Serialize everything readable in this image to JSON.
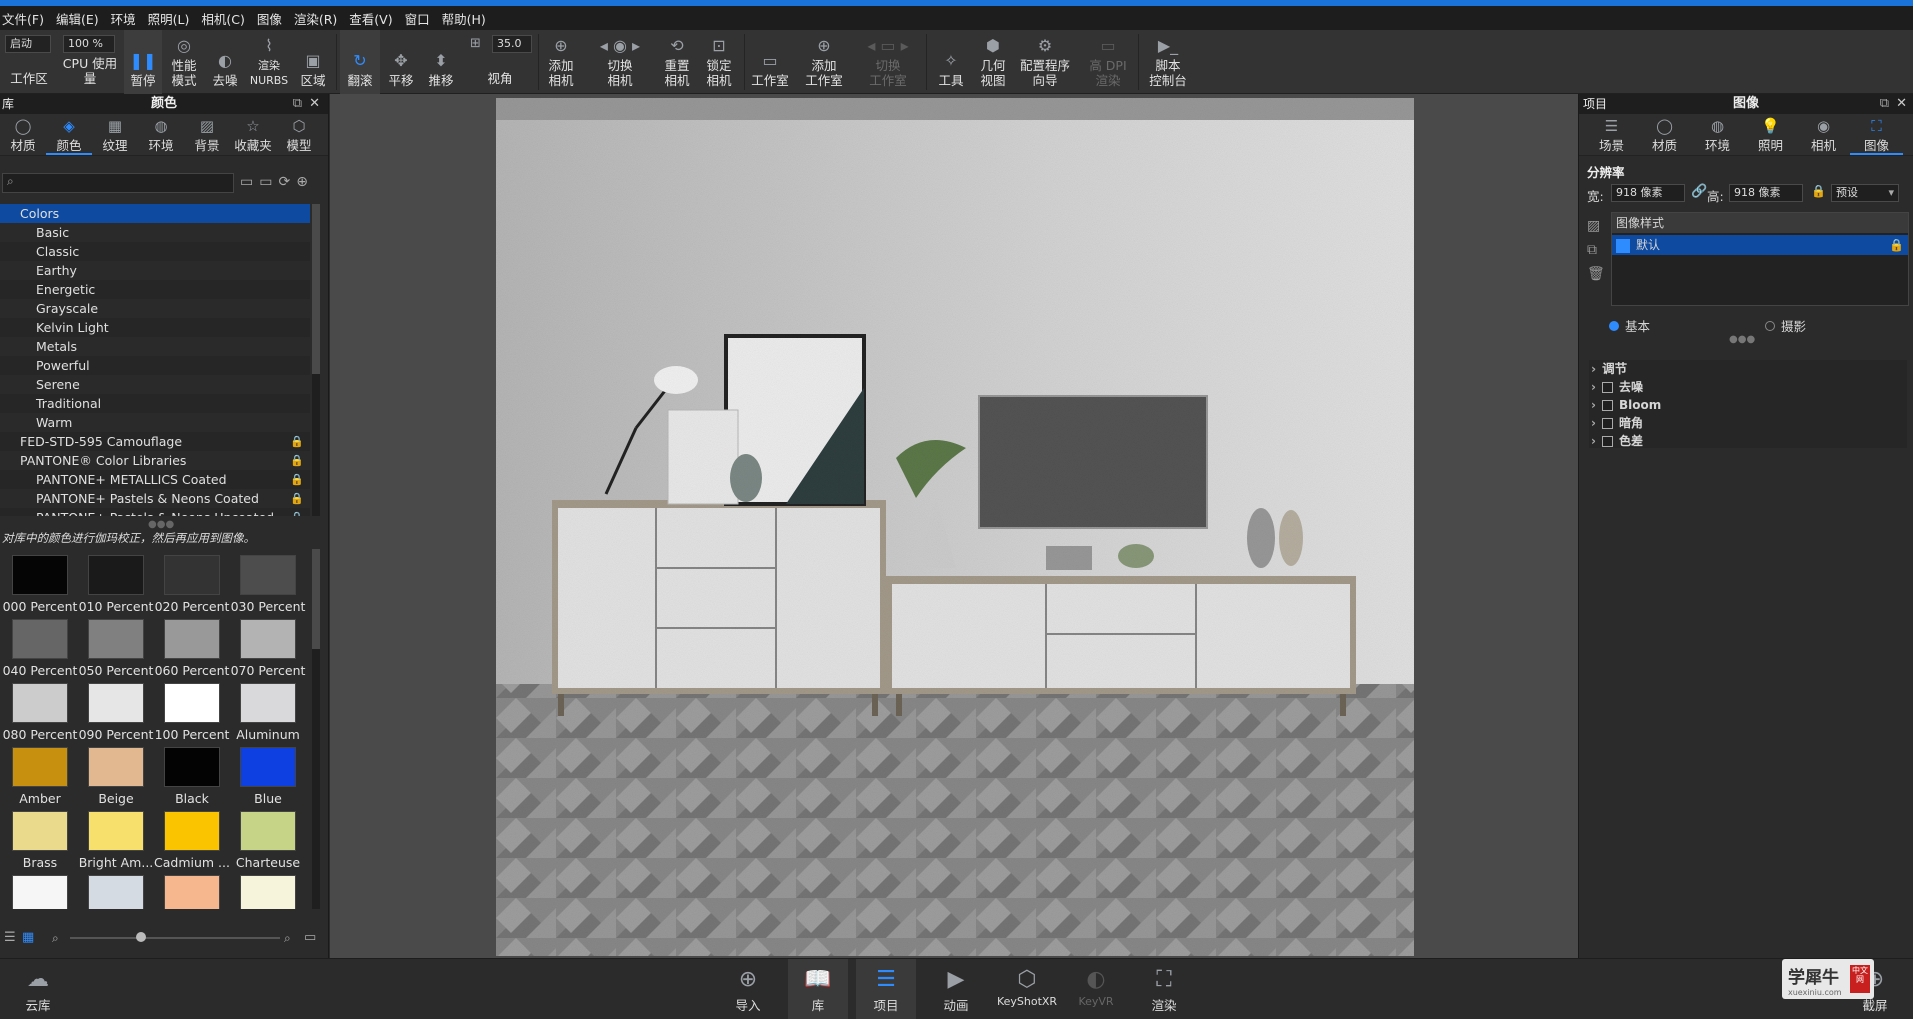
{
  "menu": [
    "文件(F)",
    "编辑(E)",
    "环境",
    "照明(L)",
    "相机(C)",
    "图像",
    "渲染(R)",
    "查看(V)",
    "窗口",
    "帮助(H)"
  ],
  "toolbar": {
    "workspace_value": "启动",
    "workspace_label": "工作区",
    "cpu_value": "100 %",
    "cpu_label": "CPU 使用量",
    "pause": "暂停",
    "perf": "性能\n模式",
    "denoise": "去噪",
    "nurbs": "渲染\nNURBS",
    "region": "区域",
    "tumble": "翻滚",
    "pan": "平移",
    "dolly": "推移",
    "fov_value": "35.0",
    "fov": "视角",
    "add_camera": "添加\n相机",
    "switch_camera": "切换\n相机",
    "reset_camera": "重置\n相机",
    "lock_camera": "锁定\n相机",
    "studio": "工作室",
    "add_studio": "添加\n工作室",
    "switch_studio": "切换\n工作室",
    "tools": "工具",
    "geometry_view": "几何\n视图",
    "config_wizard": "配置程序\n向导",
    "hidpi": "高 DPI\n渲染",
    "script": "脚本\n控制台"
  },
  "left": {
    "lib_label": "库",
    "title": "颜色",
    "tabs": [
      "材质",
      "颜色",
      "纹理",
      "环境",
      "背景",
      "收藏夹",
      "模型"
    ],
    "tree": [
      {
        "label": "Colors",
        "sel": true,
        "indent": 1
      },
      {
        "label": "Basic",
        "indent": 2
      },
      {
        "label": "Classic",
        "indent": 2
      },
      {
        "label": "Earthy",
        "indent": 2
      },
      {
        "label": "Energetic",
        "indent": 2
      },
      {
        "label": "Grayscale",
        "indent": 2
      },
      {
        "label": "Kelvin Light",
        "indent": 2
      },
      {
        "label": "Metals",
        "indent": 2
      },
      {
        "label": "Powerful",
        "indent": 2
      },
      {
        "label": "Serene",
        "indent": 2
      },
      {
        "label": "Traditional",
        "indent": 2
      },
      {
        "label": "Warm",
        "indent": 2
      },
      {
        "label": "FED-STD-595 Camouflage",
        "indent": 1,
        "lock": true
      },
      {
        "label": "PANTONE® Color Libraries",
        "indent": 1,
        "lock": true
      },
      {
        "label": "PANTONE+ METALLICS Coated",
        "indent": 2,
        "lock": true
      },
      {
        "label": "PANTONE+ Pastels & Neons Coated",
        "indent": 2,
        "lock": true
      },
      {
        "label": "PANTONE+ Pastels & Neons Uncoated",
        "indent": 2,
        "lock": true
      }
    ],
    "hint": "对库中的颜色进行伽玛校正，然后再应用到图像。",
    "swatches": [
      {
        "name": "000 Percent",
        "color": "#050505"
      },
      {
        "name": "010 Percent",
        "color": "#1a1a1a"
      },
      {
        "name": "020 Percent",
        "color": "#333333"
      },
      {
        "name": "030 Percent",
        "color": "#4d4d4d"
      },
      {
        "name": "040 Percent",
        "color": "#666666"
      },
      {
        "name": "050 Percent",
        "color": "#808080"
      },
      {
        "name": "060 Percent",
        "color": "#999999"
      },
      {
        "name": "070 Percent",
        "color": "#b3b3b3"
      },
      {
        "name": "080 Percent",
        "color": "#cccccc"
      },
      {
        "name": "090 Percent",
        "color": "#e6e6e6"
      },
      {
        "name": "100 Percent",
        "color": "#ffffff"
      },
      {
        "name": "Aluminum",
        "color": "#d9d9db"
      },
      {
        "name": "Amber",
        "color": "#c8900f"
      },
      {
        "name": "Beige",
        "color": "#e1b890"
      },
      {
        "name": "Black",
        "color": "#030303"
      },
      {
        "name": "Blue",
        "color": "#0e3fe0"
      },
      {
        "name": "Brass",
        "color": "#eadb8c"
      },
      {
        "name": "Bright Am...",
        "color": "#f8e06c"
      },
      {
        "name": "Cadmium ...",
        "color": "#fbc400"
      },
      {
        "name": "Charteuse",
        "color": "#c6d488"
      },
      {
        "name": "",
        "color": "#f6f6f6"
      },
      {
        "name": "",
        "color": "#d5dbe3"
      },
      {
        "name": "",
        "color": "#f6b78f"
      },
      {
        "name": "",
        "color": "#f7f4dc"
      }
    ]
  },
  "right": {
    "project_label": "项目",
    "title": "图像",
    "tabs": [
      "场景",
      "材质",
      "环境",
      "照明",
      "相机",
      "图像"
    ],
    "resolution": "分辨率",
    "width_label": "宽:",
    "width_value": "918 像素",
    "height_label": "高:",
    "height_value": "918 像素",
    "preset": "预设",
    "style_header": "图像样式",
    "style_item": "默认",
    "mode_basic": "基本",
    "mode_photo": "摄影",
    "adjust": "调节",
    "options": [
      "去噪",
      "Bloom",
      "暗角",
      "色差"
    ]
  },
  "bottom": {
    "cloud": "云库",
    "items": [
      "导入",
      "库",
      "项目",
      "动画",
      "KeyShotXR",
      "KeyVR",
      "渲染"
    ],
    "screenshot": "截屏"
  },
  "watermark": {
    "text": "学犀牛",
    "url": "xuexiniu.com",
    "badge": "中文网"
  },
  "colors": {
    "accent": "#2f8cff",
    "selection": "#0e4aa0"
  }
}
